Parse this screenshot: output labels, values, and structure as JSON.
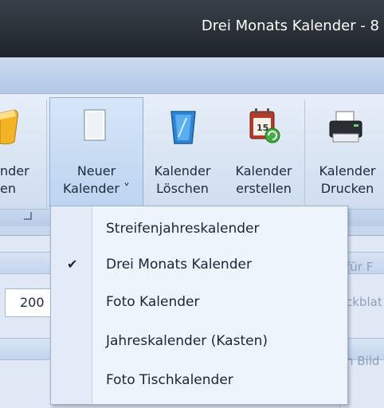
{
  "window": {
    "title": "Drei Monats Kalender - 8"
  },
  "ribbon": {
    "left_partial": {
      "line1": "nder",
      "line2": "en"
    },
    "neuer_kalender": {
      "line1": "Neuer",
      "line2": "Kalender ˅"
    },
    "kalender_loeschen": {
      "line1": "Kalender",
      "line2": "Löschen"
    },
    "kalender_erstellen": {
      "line1": "Kalender",
      "line2": "erstellen"
    },
    "kalender_drucken": {
      "line1": "Kalender",
      "line2": "Drucken"
    },
    "calendar_icon_number": "15"
  },
  "workspace": {
    "year_value": "200",
    "ghost_1": "für F",
    "ghost_2": "ckblat",
    "ghost_3": "n Bild"
  },
  "menu": {
    "items": [
      {
        "label": "Streifenjahreskalender",
        "checked": false
      },
      {
        "label": "Drei Monats Kalender",
        "checked": true,
        "check_glyph": "✔"
      },
      {
        "label": "Foto Kalender",
        "checked": false
      },
      {
        "label": "Jahreskalender (Kasten)",
        "checked": false
      },
      {
        "label": "Foto Tischkalender",
        "checked": false
      }
    ]
  },
  "colors": {
    "titlebar": "#2a2f36",
    "menu_bg": "#eef4fb",
    "ribbon": "#dde8f5"
  }
}
